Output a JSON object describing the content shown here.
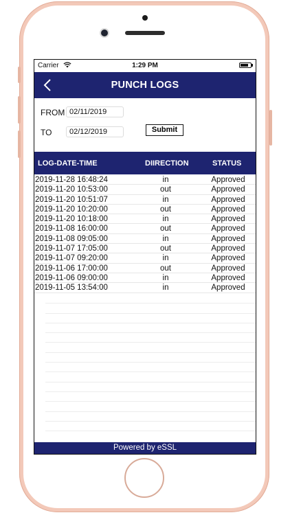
{
  "status_bar": {
    "carrier": "Carrier",
    "time": "1:29 PM",
    "wifi_icon": "wifi-icon",
    "battery_icon": "battery-icon"
  },
  "header": {
    "title": "PUNCH LOGS",
    "back_icon": "chevron-left-icon",
    "color": "#1e2470"
  },
  "form": {
    "from_label": "FROM",
    "from_value": "02/11/2019",
    "to_label": "TO",
    "to_value": "02/12/2019",
    "submit_label": "Submit"
  },
  "table": {
    "columns": [
      "LOG-DATE-TIME",
      "DIIRECTION",
      "STATUS"
    ],
    "rows": [
      {
        "datetime": "2019-11-28 16:48:24",
        "direction": "in",
        "status": "Approved"
      },
      {
        "datetime": "2019-11-20 10:53:00",
        "direction": "out",
        "status": "Approved"
      },
      {
        "datetime": "2019-11-20 10:51:07",
        "direction": "in",
        "status": "Approved"
      },
      {
        "datetime": "2019-11-20 10:20:00",
        "direction": "out",
        "status": "Approved"
      },
      {
        "datetime": "2019-11-20 10:18:00",
        "direction": "in",
        "status": "Approved"
      },
      {
        "datetime": "2019-11-08 16:00:00",
        "direction": "out",
        "status": "Approved"
      },
      {
        "datetime": "2019-11-08 09:05:00",
        "direction": "in",
        "status": "Approved"
      },
      {
        "datetime": "2019-11-07 17:05:00",
        "direction": "out",
        "status": "Approved"
      },
      {
        "datetime": "2019-11-07 09:20:00",
        "direction": "in",
        "status": "Approved"
      },
      {
        "datetime": "2019-11-06 17:00:00",
        "direction": "out",
        "status": "Approved"
      },
      {
        "datetime": "2019-11-06 09:00:00",
        "direction": "in",
        "status": "Approved"
      },
      {
        "datetime": "2019-11-05 13:54:00",
        "direction": "in",
        "status": "Approved"
      }
    ]
  },
  "footer": {
    "text": "Powered by eSSL"
  }
}
